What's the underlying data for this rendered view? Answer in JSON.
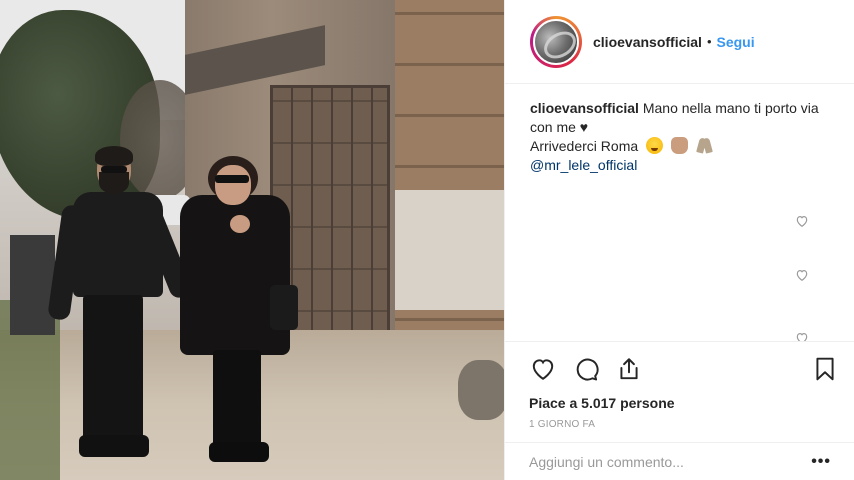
{
  "header": {
    "username": "clioevansofficial",
    "separator": "•",
    "follow_label": "Segui"
  },
  "caption": {
    "username": "clioevansofficial",
    "line1": "Mano nella mano ti porto via con me ♥",
    "line2": "Arrivederci Roma",
    "emojis": [
      "star-struck-emoji",
      "clapping-hands-emoji",
      "folded-hands-emoji"
    ],
    "mention": "@mr_lele_official"
  },
  "actions": {
    "icons": [
      "heart-icon",
      "comment-icon",
      "share-icon",
      "bookmark-icon"
    ],
    "likes_text": "Piace a 5.017 persone",
    "time_text": "1 GIORNO FA"
  },
  "add_comment": {
    "placeholder": "Aggiungi un commento...",
    "more_label": "•••"
  },
  "colors": {
    "accent": "#3897f0",
    "mention": "#003569",
    "text": "#262626",
    "muted": "#999999",
    "border": "#efefef"
  }
}
